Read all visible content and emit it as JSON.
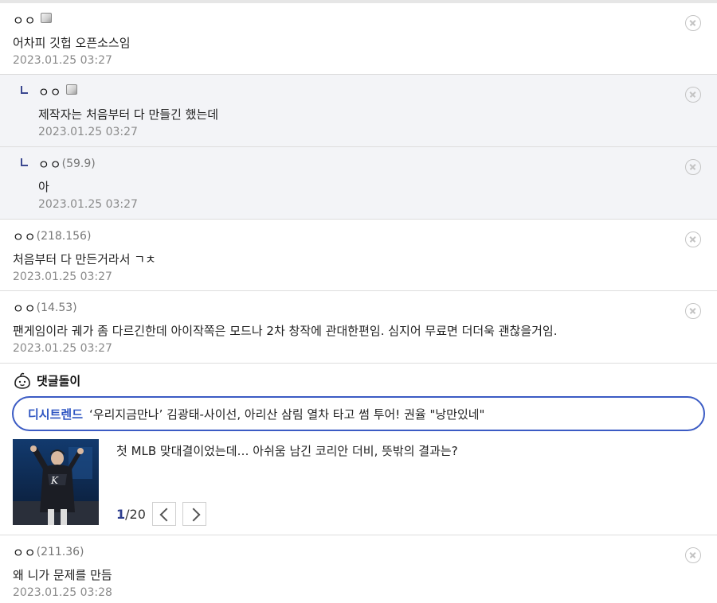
{
  "comments": [
    {
      "nick": "ㅇㅇ",
      "ip": "",
      "member": true,
      "reply": false,
      "text": "어차피 깃헙 오픈소스임",
      "date": "2023.01.25 03:27"
    },
    {
      "nick": "ㅇㅇ",
      "ip": "",
      "member": true,
      "reply": true,
      "text": "제작자는 처음부터 다 만들긴 했는데",
      "date": "2023.01.25 03:27"
    },
    {
      "nick": "ㅇㅇ",
      "ip": "(59.9)",
      "member": false,
      "reply": true,
      "text": "아",
      "date": "2023.01.25 03:27"
    },
    {
      "nick": "ㅇㅇ",
      "ip": "(218.156)",
      "member": false,
      "reply": false,
      "text": "처음부터 다 만든거라서 ㄱㅊ",
      "date": "2023.01.25 03:27"
    },
    {
      "nick": "ㅇㅇ",
      "ip": "(14.53)",
      "member": false,
      "reply": false,
      "text": "팬게임이라 궤가 좀 다르긴한데 아이작쪽은 모드나 2차 창작에 관대한편임. 심지어 무료면 더더욱 괜찮을거임.",
      "date": "2023.01.25 03:27"
    },
    {
      "nick": "ㅇㅇ",
      "ip": "(211.36)",
      "member": false,
      "reply": false,
      "text": "왜 니가 문제를 만듬",
      "date": "2023.01.25 03:28"
    }
  ],
  "dol": {
    "title": "댓글돌이",
    "trend_label": "디시트렌드",
    "trend_text": "‘우리지금만나’ 김광태-사이선, 아리산 삼림 열차 타고 썸 투어! 권율 \"낭만있네\"",
    "news_title": "첫 MLB 맞대결이었는데… 아쉬움 남긴 코리안 더비, 뜻밖의 결과는?",
    "page_current": "1",
    "page_total": "/20"
  },
  "icons": {
    "delete": "circle-x-icon",
    "member": "member-badge-icon",
    "reply": "reply-arrow-icon",
    "dol": "dol-face-icon",
    "prev": "chevron-left-icon",
    "next": "chevron-right-icon"
  },
  "colors": {
    "accent": "#2e55c2",
    "reply_bg": "#f3f4f7",
    "navy": "#3b4890"
  }
}
